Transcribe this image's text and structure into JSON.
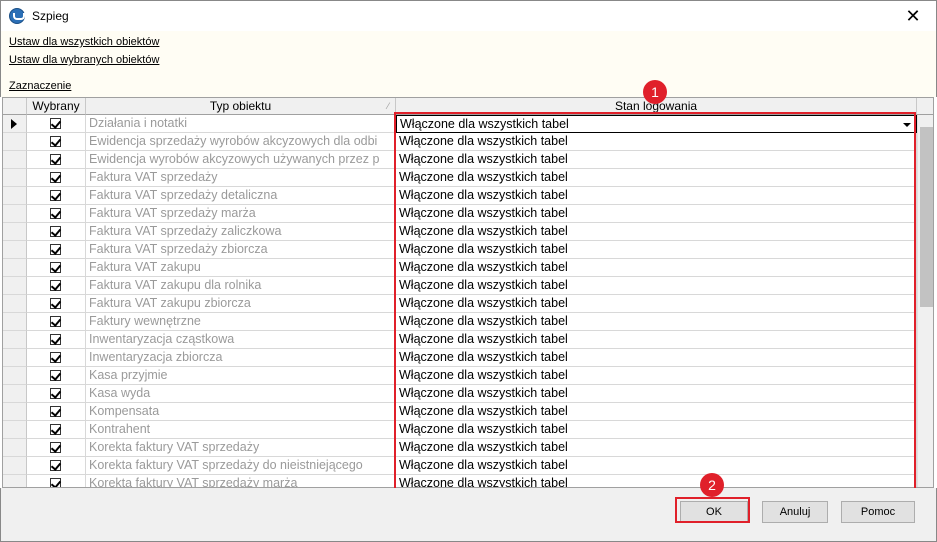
{
  "window": {
    "title": "Szpieg"
  },
  "links": {
    "set_all": "Ustaw dla wszystkich obiektów",
    "set_selected": "Ustaw dla wybranych obiektów",
    "selection": "Zaznaczenie"
  },
  "grid": {
    "headers": {
      "selected": "Wybrany",
      "type": "Typ obiektu",
      "state": "Stan logowania"
    },
    "rows": [
      {
        "checked": true,
        "type": "Działania i notatki",
        "state": "Włączone dla wszystkich tabel"
      },
      {
        "checked": true,
        "type": "Ewidencja sprzedaży wyrobów akcyzowych dla odbi",
        "state": "Włączone dla wszystkich tabel"
      },
      {
        "checked": true,
        "type": "Ewidencja wyrobów akcyzowych używanych przez p",
        "state": "Włączone dla wszystkich tabel"
      },
      {
        "checked": true,
        "type": "Faktura VAT sprzedaży",
        "state": "Włączone dla wszystkich tabel"
      },
      {
        "checked": true,
        "type": "Faktura VAT sprzedaży detaliczna",
        "state": "Włączone dla wszystkich tabel"
      },
      {
        "checked": true,
        "type": "Faktura VAT sprzedaży marża",
        "state": "Włączone dla wszystkich tabel"
      },
      {
        "checked": true,
        "type": "Faktura VAT sprzedaży zaliczkowa",
        "state": "Włączone dla wszystkich tabel"
      },
      {
        "checked": true,
        "type": "Faktura VAT sprzedaży zbiorcza",
        "state": "Włączone dla wszystkich tabel"
      },
      {
        "checked": true,
        "type": "Faktura VAT zakupu",
        "state": "Włączone dla wszystkich tabel"
      },
      {
        "checked": true,
        "type": "Faktura VAT zakupu dla rolnika",
        "state": "Włączone dla wszystkich tabel"
      },
      {
        "checked": true,
        "type": "Faktura VAT zakupu zbiorcza",
        "state": "Włączone dla wszystkich tabel"
      },
      {
        "checked": true,
        "type": "Faktury wewnętrzne",
        "state": "Włączone dla wszystkich tabel"
      },
      {
        "checked": true,
        "type": "Inwentaryzacja cząstkowa",
        "state": "Włączone dla wszystkich tabel"
      },
      {
        "checked": true,
        "type": "Inwentaryzacja zbiorcza",
        "state": "Włączone dla wszystkich tabel"
      },
      {
        "checked": true,
        "type": "Kasa przyjmie",
        "state": "Włączone dla wszystkich tabel"
      },
      {
        "checked": true,
        "type": "Kasa wyda",
        "state": "Włączone dla wszystkich tabel"
      },
      {
        "checked": true,
        "type": "Kompensata",
        "state": "Włączone dla wszystkich tabel"
      },
      {
        "checked": true,
        "type": "Kontrahent",
        "state": "Włączone dla wszystkich tabel"
      },
      {
        "checked": true,
        "type": "Korekta faktury VAT sprzedaży",
        "state": "Włączone dla wszystkich tabel"
      },
      {
        "checked": true,
        "type": "Korekta faktury VAT sprzedaży do nieistniejącego",
        "state": "Włączone dla wszystkich tabel"
      },
      {
        "checked": true,
        "type": "Korekta faktury VAT sprzedaży marża",
        "state": "Włączone dla wszystkich tabel"
      }
    ]
  },
  "annotations": {
    "badge1": "1",
    "badge2": "2",
    "color": "#e0202a"
  },
  "buttons": {
    "ok": "OK",
    "cancel": "Anuluj",
    "help": "Pomoc"
  },
  "icons": {
    "app": "app-logo-icon",
    "close": "close-icon",
    "row_indicator": "row-pointer-icon",
    "dropdown": "dropdown-arrow-icon",
    "sort": "sort-indicator-icon"
  }
}
